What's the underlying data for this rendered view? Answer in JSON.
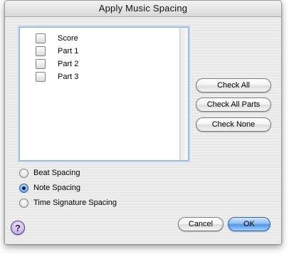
{
  "window": {
    "title": "Apply Music Spacing"
  },
  "list": {
    "items": [
      {
        "label": "Score",
        "checked": false
      },
      {
        "label": "Part 1",
        "checked": false
      },
      {
        "label": "Part 2",
        "checked": false
      },
      {
        "label": "Part 3",
        "checked": false
      }
    ]
  },
  "side_buttons": {
    "check_all": "Check All",
    "check_all_parts": "Check All Parts",
    "check_none": "Check None"
  },
  "spacing_options": [
    {
      "label": "Beat Spacing",
      "selected": false
    },
    {
      "label": "Note Spacing",
      "selected": true
    },
    {
      "label": "Time Signature Spacing",
      "selected": false
    }
  ],
  "footer": {
    "help_symbol": "?",
    "cancel_label": "Cancel",
    "ok_label": "OK"
  }
}
